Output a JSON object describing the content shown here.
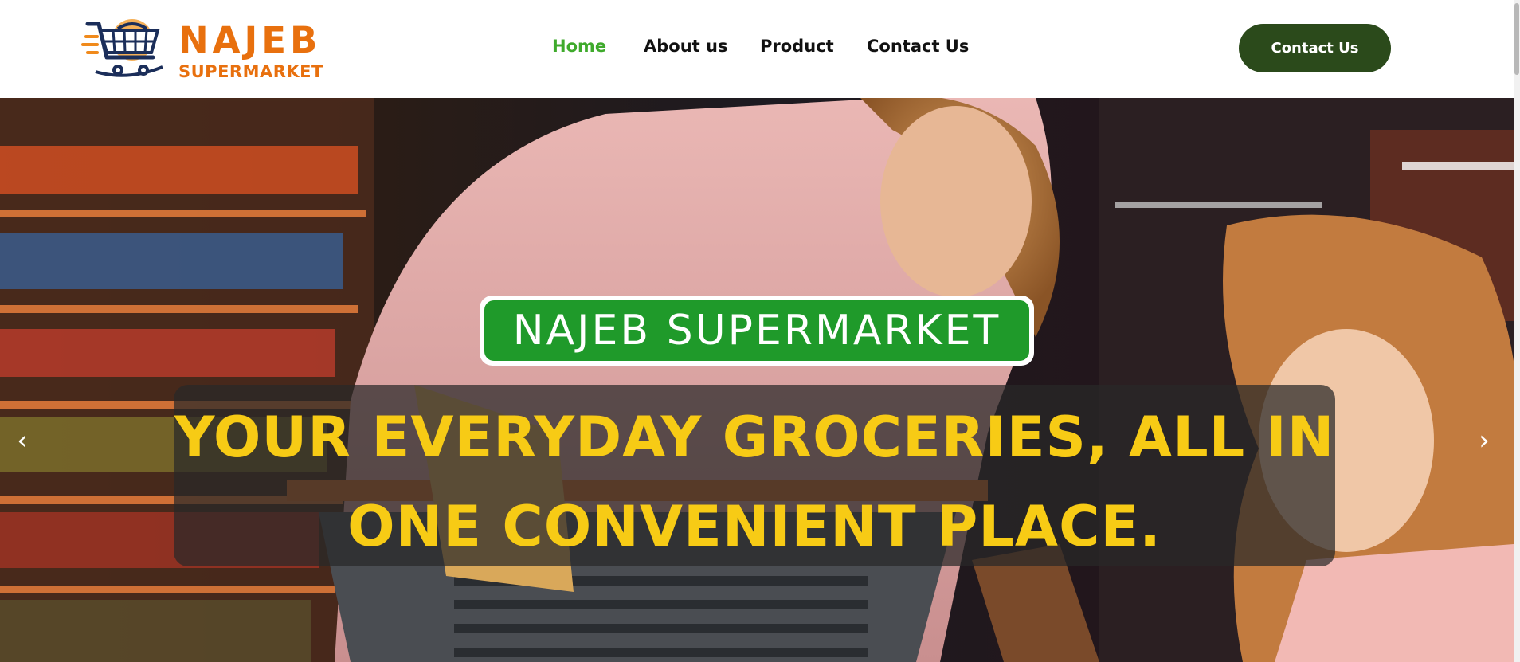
{
  "brand": {
    "name_line1": "NAJEB",
    "name_line2": "SUPERMARKET",
    "logo_icon": "shopping-cart-icon",
    "brand_color": "#e8700e"
  },
  "nav": {
    "items": [
      {
        "label": "Home",
        "active": true
      },
      {
        "label": "About us",
        "active": false
      },
      {
        "label": "Product",
        "active": false
      },
      {
        "label": "Contact Us",
        "active": false
      }
    ],
    "active_color": "#3faa2c"
  },
  "cta": {
    "label": "Contact Us",
    "color": "#2b4a1b"
  },
  "hero": {
    "badge_text": "NAJEB SUPERMARKET",
    "badge_color": "#1f9a2a",
    "tagline_line1": "YOUR EVERYDAY GROCERIES, ALL IN",
    "tagline_line2": "ONE CONVENIENT PLACE.",
    "tagline_color": "#f7cb15",
    "prev_icon": "chevron-left-icon",
    "next_icon": "chevron-right-icon"
  }
}
